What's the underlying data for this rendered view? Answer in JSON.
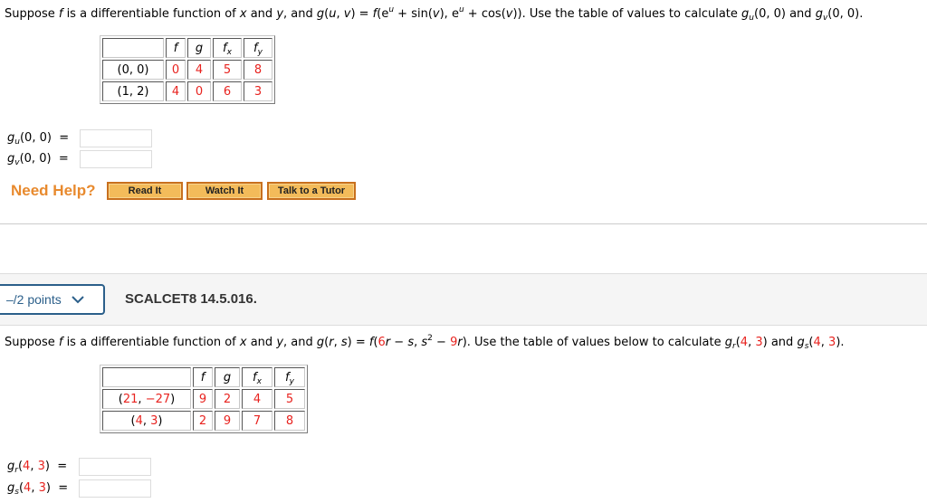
{
  "q1": {
    "prompt": {
      "p1": "Suppose ",
      "f": "f",
      "p2": " is a differentiable function of ",
      "x": "x",
      "p3": " and ",
      "y": "y",
      "p4": ", and  ",
      "g": "g",
      "p5": "(",
      "u": "u",
      "p6": ", ",
      "v": "v",
      "p7": ") = ",
      "f2": "f",
      "p8": "(e",
      "sup1": "u",
      "p9": " + sin(",
      "v2": "v",
      "p10": "), e",
      "sup2": "u",
      "p11": " + cos(",
      "v3": "v",
      "p12": ")).  Use the table of values to calculate  ",
      "gu_g": "g",
      "gu_sub": "u",
      "gu_arg": "(0, 0)",
      "p13": "  and  ",
      "gv_g": "g",
      "gv_sub": "v",
      "gv_arg": "(0, 0)",
      "p14": "."
    },
    "table": {
      "headers": [
        "",
        "f",
        "g",
        "f",
        "f"
      ],
      "header_subs": [
        "",
        "",
        "",
        "x",
        "y"
      ],
      "rows": [
        {
          "point": "(0, 0)",
          "f": "0",
          "g": "4",
          "fx": "5",
          "fy": "8"
        },
        {
          "point": "(1, 2)",
          "f": "4",
          "g": "0",
          "fx": "6",
          "fy": "3"
        }
      ]
    },
    "answers": [
      {
        "g": "g",
        "sub": "u",
        "arg": "(0, 0)",
        "eq": "=",
        "value": ""
      },
      {
        "g": "g",
        "sub": "v",
        "arg": "(0, 0)",
        "eq": "=",
        "value": ""
      }
    ],
    "help": {
      "label": "Need Help?",
      "buttons": [
        "Read It",
        "Watch It",
        "Talk to a Tutor"
      ]
    }
  },
  "q2_header": {
    "points_label": "–/2 points",
    "chevron": "chevron-down-icon",
    "question_id": "SCALCET8 14.5.016."
  },
  "q2": {
    "prompt": {
      "p1": "Suppose ",
      "f": "f",
      "p2": " is a differentiable function of ",
      "x": "x",
      "p3": " and ",
      "y": "y",
      "p4": ", and  ",
      "g": "g",
      "p5": "(",
      "r": "r",
      "p6": ", ",
      "s": "s",
      "p7": ") = ",
      "f2": "f",
      "p8": "(",
      "c6": "6",
      "r2": "r",
      "p9": " − ",
      "s2": "s",
      "p10": ", ",
      "s3": "s",
      "sup": "2",
      "p11": " − ",
      "c9": "9",
      "r3": "r",
      "p12": ").  Use the table of values below to calculate  ",
      "gr_g": "g",
      "gr_sub": "r",
      "gr_a": "4",
      "gr_b": "3",
      "p13": "  and  ",
      "gs_g": "g",
      "gs_sub": "s",
      "gs_a": "4",
      "gs_b": "3",
      "p14": "."
    },
    "table": {
      "headers": [
        "",
        "f",
        "g",
        "f",
        "f"
      ],
      "header_subs": [
        "",
        "",
        "",
        "x",
        "y"
      ],
      "rows": [
        {
          "pa": "21",
          "pb": "−27",
          "f": "9",
          "g": "2",
          "fx": "4",
          "fy": "5"
        },
        {
          "pa": "4",
          "pb": "3",
          "f": "2",
          "g": "9",
          "fx": "7",
          "fy": "8"
        }
      ]
    },
    "answers": [
      {
        "g": "g",
        "sub": "r",
        "a": "4",
        "b": "3",
        "eq": "=",
        "value": ""
      },
      {
        "g": "g",
        "sub": "s",
        "a": "4",
        "b": "3",
        "eq": "=",
        "value": ""
      }
    ]
  },
  "colors": {
    "accent_red": "#e8231f",
    "help_orange": "#e88a2e",
    "button_fill": "#f3bb5a",
    "points_blue": "#2b5f8a"
  }
}
